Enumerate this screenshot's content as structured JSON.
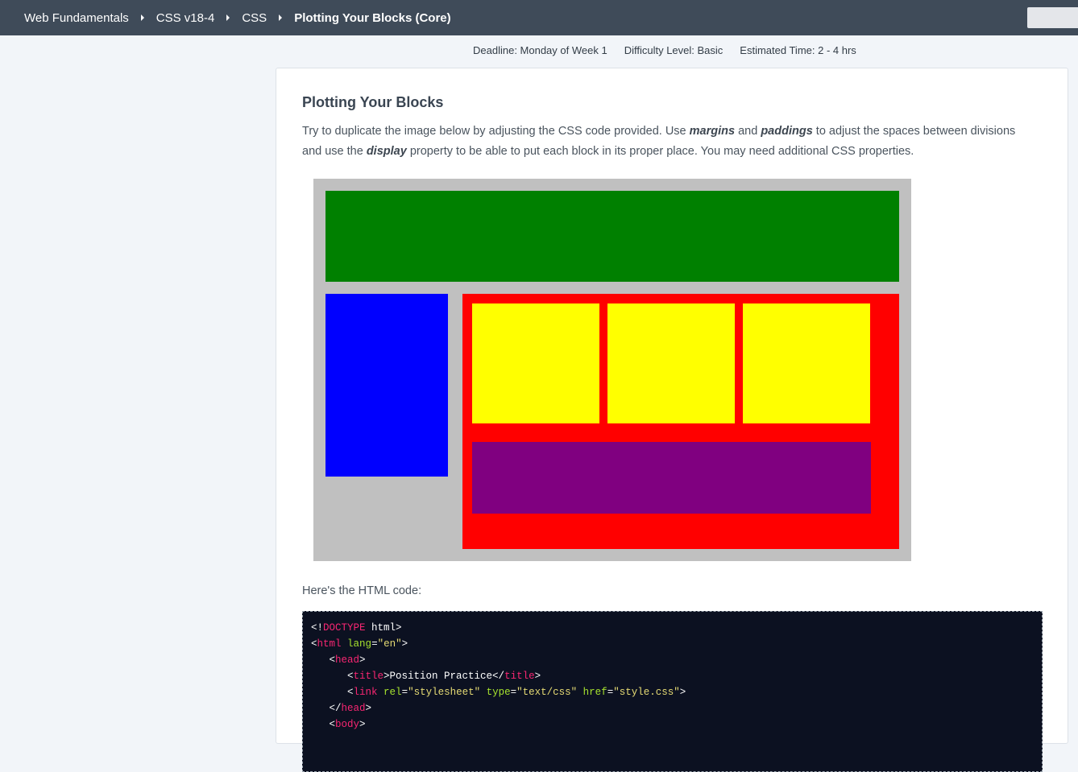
{
  "breadcrumbs": [
    "Web Fundamentals",
    "CSS v18-4",
    "CSS",
    "Plotting Your Blocks (Core)"
  ],
  "meta": {
    "deadline": "Deadline: Monday of Week 1",
    "difficulty": "Difficulty Level: Basic",
    "time": "Estimated Time: 2 - 4 hrs"
  },
  "assignment": {
    "title": "Plotting Your Blocks",
    "desc_1": "Try to duplicate the image below by adjusting the CSS code provided. Use ",
    "desc_em_1": "margins",
    "desc_2": " and ",
    "desc_em_2": "paddings",
    "desc_3": " to adjust the spaces between divisions and use the ",
    "desc_em_3": "display",
    "desc_4": " property to be able to put each block in its proper place. You may need additional CSS properties.",
    "html_label": "Here's the HTML code:"
  },
  "figure_colors": {
    "background": "#c0c0c0",
    "header": "#008000",
    "sidebar": "#0000ff",
    "main": "#ff0000",
    "boxes": "#ffff00",
    "footer": "#800080"
  },
  "code_lines": [
    [
      [
        "plain",
        "<!"
      ],
      [
        "tag",
        "DOCTYPE"
      ],
      [
        "plain",
        " html>"
      ]
    ],
    [
      [
        "plain",
        "<"
      ],
      [
        "tag",
        "html"
      ],
      [
        "plain",
        " "
      ],
      [
        "attr",
        "lang"
      ],
      [
        "plain",
        "="
      ],
      [
        "str",
        "\"en\""
      ],
      [
        "plain",
        ">"
      ]
    ],
    [
      [
        "plain",
        "   <"
      ],
      [
        "tag",
        "head"
      ],
      [
        "plain",
        ">"
      ]
    ],
    [
      [
        "plain",
        "      <"
      ],
      [
        "tag",
        "title"
      ],
      [
        "plain",
        ">Position Practice</"
      ],
      [
        "tag",
        "title"
      ],
      [
        "plain",
        ">"
      ]
    ],
    [
      [
        "plain",
        "      <"
      ],
      [
        "tag",
        "link"
      ],
      [
        "plain",
        " "
      ],
      [
        "attr",
        "rel"
      ],
      [
        "plain",
        "="
      ],
      [
        "str",
        "\"stylesheet\""
      ],
      [
        "plain",
        " "
      ],
      [
        "attr",
        "type"
      ],
      [
        "plain",
        "="
      ],
      [
        "str",
        "\"text/css\""
      ],
      [
        "plain",
        " "
      ],
      [
        "attr",
        "href"
      ],
      [
        "plain",
        "="
      ],
      [
        "str",
        "\"style.css\""
      ],
      [
        "plain",
        ">"
      ]
    ],
    [
      [
        "plain",
        "   </"
      ],
      [
        "tag",
        "head"
      ],
      [
        "plain",
        ">"
      ]
    ],
    [
      [
        "plain",
        "   <"
      ],
      [
        "tag",
        "body"
      ],
      [
        "plain",
        ">"
      ]
    ]
  ]
}
